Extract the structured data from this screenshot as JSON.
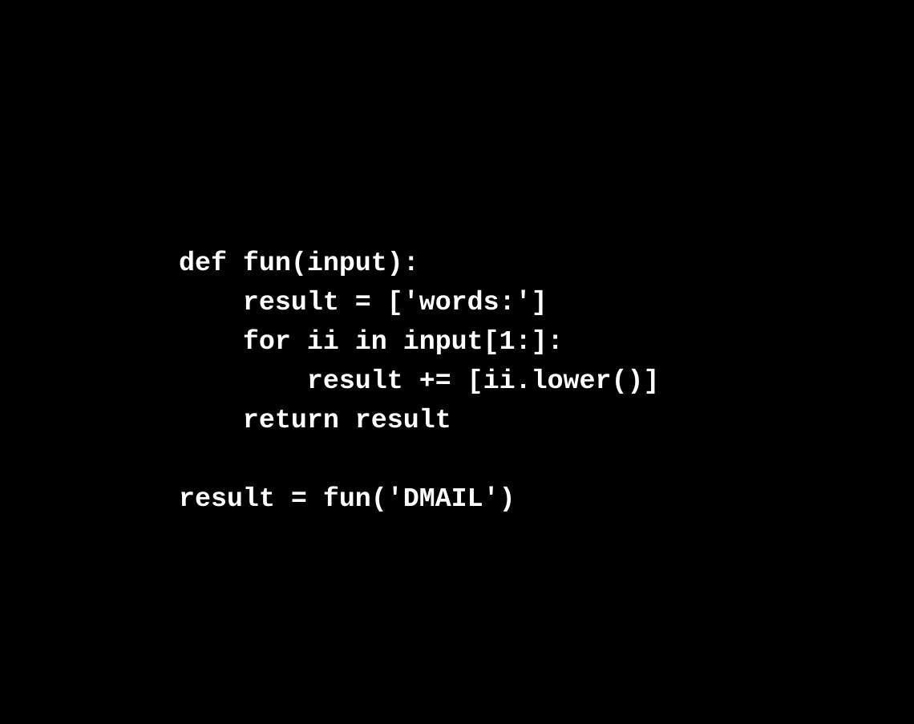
{
  "code": {
    "lines": [
      "def fun(input):",
      "    result = ['words:']",
      "    for ii in input[1:]:",
      "        result += [ii.lower()]",
      "    return result",
      "",
      "result = fun('DMAIL')"
    ]
  },
  "colors": {
    "background": "#000000",
    "text": "#ffffff"
  }
}
